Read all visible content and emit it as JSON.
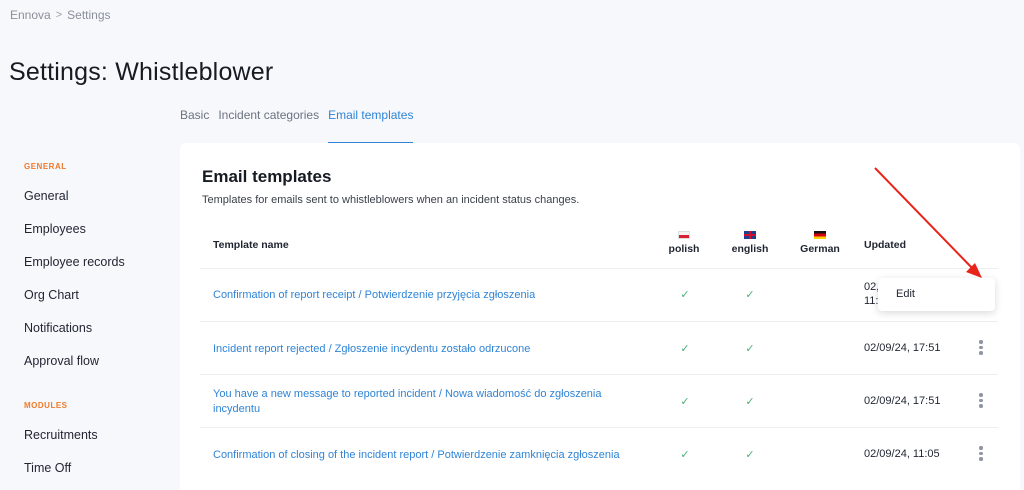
{
  "breadcrumb": {
    "root": "Ennova",
    "separator": ">",
    "current": "Settings"
  },
  "page": {
    "title": "Settings: Whistleblower"
  },
  "tabs": [
    {
      "label": "Basic"
    },
    {
      "label": "Incident categories"
    },
    {
      "label": "Email templates"
    }
  ],
  "sidebar": {
    "general_section": "GENERAL",
    "general_items": [
      "General",
      "Employees",
      "Employee records",
      "Org Chart",
      "Notifications",
      "Approval flow"
    ],
    "modules_section": "MODULES",
    "modules_items": [
      "Recruitments",
      "Time Off"
    ]
  },
  "card": {
    "title": "Email templates",
    "subtitle": "Templates for emails sent to whistleblowers when an incident status changes."
  },
  "table": {
    "headers": {
      "name": "Template name",
      "polish": "polish",
      "english": "english",
      "german": "German",
      "updated": "Updated"
    },
    "rows": [
      {
        "name": "Confirmation of report receipt / Potwierdzenie przyjęcia zgłoszenia",
        "updated_partial": "02,",
        "updated_partial2": "11:0"
      },
      {
        "name": "Incident report rejected / Zgłoszenie incydentu zostało odrzucone",
        "updated": "02/09/24, 17:51"
      },
      {
        "name": "You have a new message to reported incident / Nowa wiadomość do zgłoszenia incydentu",
        "updated": "02/09/24, 17:51"
      },
      {
        "name": "Confirmation of closing of the incident report / Potwierdzenie zamknięcia zgłoszenia",
        "updated": "02/09/24, 11:05"
      }
    ],
    "check_glyph": "✓"
  },
  "context_menu": {
    "edit": "Edit"
  },
  "colors": {
    "accent": "#2f84d6",
    "section": "#ef7a2a",
    "check": "#4caf78",
    "arrow": "#e8231a"
  }
}
